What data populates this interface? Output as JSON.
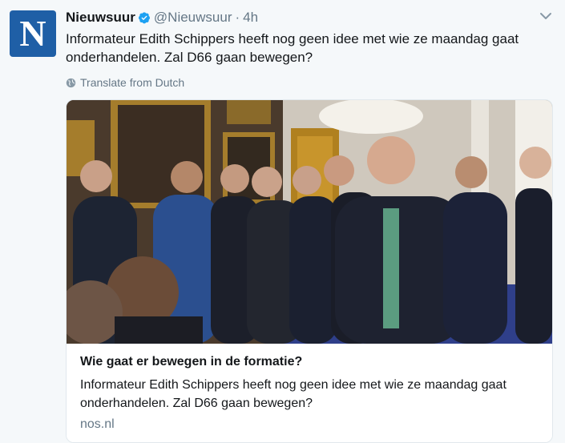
{
  "tweet": {
    "account_name": "Nieuwsuur",
    "handle": "@Nieuwsuur",
    "separator": "·",
    "time": "4h",
    "avatar_letter": "N",
    "text": "Informateur Edith Schippers heeft nog geen idee met wie ze maandag gaat onderhandelen. Zal D66 gaan bewegen?",
    "translate_label": "Translate from Dutch"
  },
  "card": {
    "title": "Wie gaat er bewegen in de formatie?",
    "description": "Informateur Edith Schippers heeft nog geen idee met wie ze maandag gaat onderhandelen. Zal D66 gaan bewegen?",
    "domain": "nos.nl"
  },
  "icons": {
    "verified": "verified-badge-icon",
    "caret": "chevron-down-icon",
    "globe": "globe-icon"
  },
  "colors": {
    "accent": "#1da1f2",
    "secondary_text": "#657786",
    "background": "#f5f8fa",
    "avatar": "#1f5fa6"
  }
}
